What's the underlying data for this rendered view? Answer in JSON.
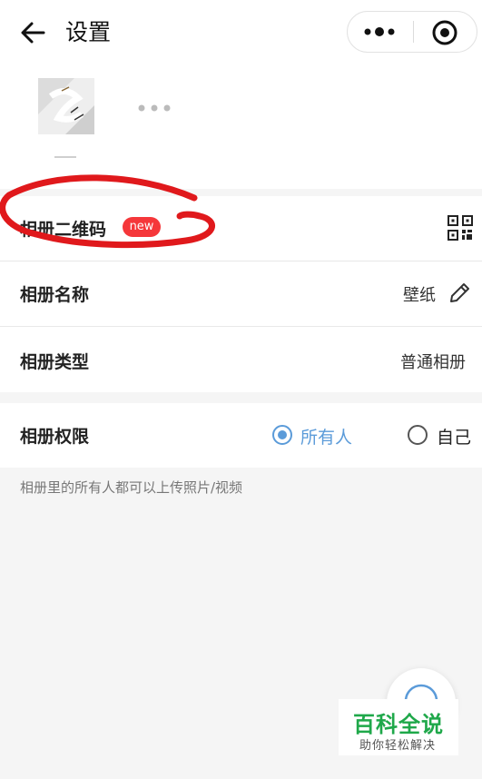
{
  "header": {
    "title": "设置",
    "back_icon": "arrow-left-icon",
    "more_icon": "more-dots-icon",
    "close_icon": "target-circle-icon"
  },
  "album": {
    "more_icon": "ellipsis-icon"
  },
  "rows": {
    "qr": {
      "label": "相册二维码",
      "badge": "new",
      "icon": "qr-code-icon"
    },
    "name": {
      "label": "相册名称",
      "value": "壁纸",
      "icon": "pencil-edit-icon"
    },
    "type": {
      "label": "相册类型",
      "value": "普通相册"
    },
    "permission": {
      "label": "相册权限",
      "options": [
        {
          "label": "所有人",
          "selected": true
        },
        {
          "label": "自己",
          "selected": false
        }
      ]
    }
  },
  "hint": "相册里的所有人都可以上传照片/视频",
  "watermark": {
    "title": "百科全说",
    "subtitle": "助你轻松解决"
  },
  "colors": {
    "accent": "#5b9bd9",
    "badge": "#f5373a",
    "annotation": "#e0191c",
    "watermark": "#1fa84a"
  }
}
